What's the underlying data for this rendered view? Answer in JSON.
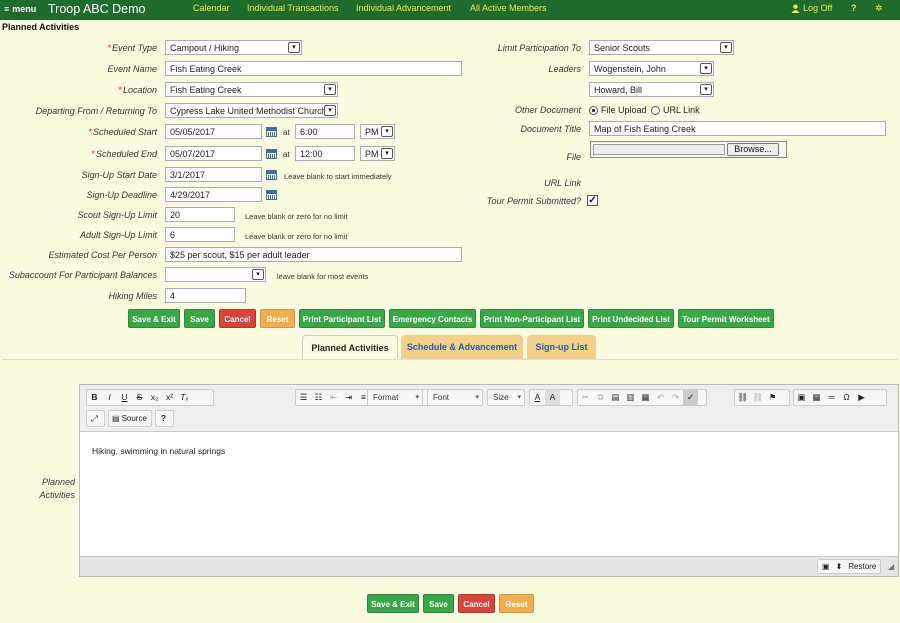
{
  "topbar": {
    "menu_label": "menu",
    "brand": "Troop ABC Demo",
    "nav": [
      "Calendar",
      "Individual Transactions",
      "Individual Advancement",
      "All Active Members"
    ],
    "logoff": "Log Off",
    "help": "?",
    "colors": {
      "bar": "#1e6b2c",
      "link": "#f2e84a"
    }
  },
  "section_title": "Planned Activities",
  "form": {
    "event_type": {
      "label": "Event Type",
      "value": "Campout / Hiking"
    },
    "event_name": {
      "label": "Event Name",
      "value": "Fish Eating Creek"
    },
    "location": {
      "label": "Location",
      "value": "Fish Eating Creek"
    },
    "departing": {
      "label": "Departing From / Returning To",
      "value": "Cypress Lake United Methodist Church"
    },
    "scheduled_start": {
      "label": "Scheduled Start",
      "date": "05/05/2017",
      "at": "at",
      "time": "6:00",
      "ampm": "PM"
    },
    "scheduled_end": {
      "label": "Scheduled End",
      "date": "05/07/2017",
      "at": "at",
      "time": "12:00",
      "ampm": "PM"
    },
    "signup_start": {
      "label": "Sign-Up Start Date",
      "value": "3/1/2017",
      "hint": "Leave blank to start immediately"
    },
    "signup_deadline": {
      "label": "Sign-Up Deadline",
      "value": "4/29/2017"
    },
    "scout_limit": {
      "label": "Scout Sign-Up Limit",
      "value": "20",
      "hint": "Leave blank or zero for no limit"
    },
    "adult_limit": {
      "label": "Adult Sign-Up Limit",
      "value": "6",
      "hint": "Leave blank or zero for no limit"
    },
    "cost": {
      "label": "Estimated Cost Per Person",
      "value": "$25 per scout, $15 per adult leader"
    },
    "subaccount": {
      "label": "Subaccount For Participant Balances",
      "value": "",
      "hint": "leave blank for most events"
    },
    "hiking_miles": {
      "label": "Hiking Miles",
      "value": "4"
    },
    "limit_participation": {
      "label": "Limit Participation To",
      "value": "Senior Scouts"
    },
    "leaders": {
      "label": "Leaders",
      "values": [
        "Wogenstein, John",
        "Howard, Bill"
      ]
    },
    "other_document": {
      "label": "Other Document",
      "options": [
        "File Upload",
        "URL Link"
      ],
      "selected": "File Upload"
    },
    "document_title": {
      "label": "Document Title",
      "value": "Map of Fish Eating Creek"
    },
    "file": {
      "label": "File",
      "browse": "Browse..."
    },
    "url_link": {
      "label": "URL Link"
    },
    "tour_permit": {
      "label": "Tour Permit Submitted?",
      "checked": true,
      "mark": "✓"
    }
  },
  "action_buttons": [
    "Save & Exit",
    "Save",
    "Cancel",
    "Reset",
    "Print Participant List",
    "Emergency Contacts",
    "Print Non-Participant List",
    "Print Undecided List",
    "Tour Permit Worksheet"
  ],
  "tabs": [
    {
      "label": "Planned Activities",
      "active": true
    },
    {
      "label": "Schedule & Advancement",
      "active": false
    },
    {
      "label": "Sign-up List",
      "active": false
    }
  ],
  "editor": {
    "field_label": "Planned Activities",
    "format": "Format",
    "font": "Font",
    "size": "Size",
    "source": "Source",
    "content": "Hiking, swimming in natural springs",
    "restore": "Restore"
  },
  "bottom_buttons": [
    "Save & Exit",
    "Save",
    "Cancel",
    "Reset"
  ]
}
